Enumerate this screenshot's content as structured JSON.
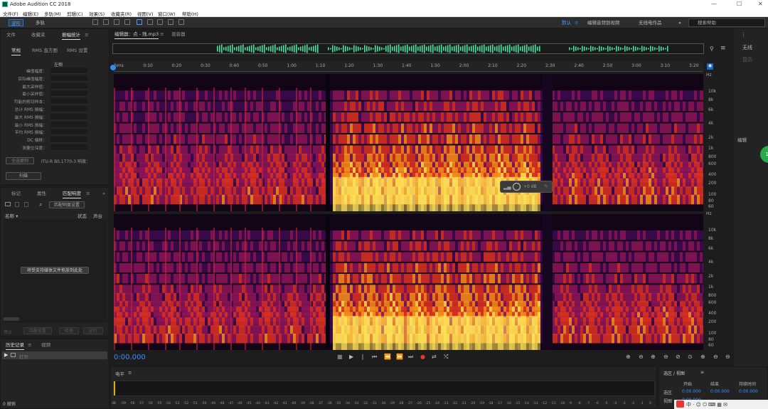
{
  "app": {
    "title": "Adobe Audition CC 2018",
    "window_controls": [
      "—",
      "☐",
      "✕"
    ]
  },
  "menu": [
    "文件(F)",
    "编辑(E)",
    "多轨(M)",
    "剪辑(C)",
    "效果(S)",
    "收藏夹(R)",
    "视图(V)",
    "窗口(W)",
    "帮助(H)"
  ],
  "toolbar": {
    "waveform": "波形",
    "multitrack": "多轨",
    "workspaces": [
      "默认",
      "编辑音频到视频",
      "无线电作品"
    ],
    "search_placeholder": "搜索帮助"
  },
  "left_top": {
    "tabs": [
      "文件",
      "收藏夹",
      "振幅统计"
    ],
    "subtabs": [
      "常规",
      "RMS 直方图",
      "RMS 设置"
    ],
    "channel": "左侧",
    "stats": [
      "峰值幅度：",
      "实际峰值幅度：",
      "最大采样值：",
      "最小采样值：",
      "可能的剪切样本：",
      "总计 RMS 振幅：",
      "最大 RMS 振幅：",
      "最小 RMS 振幅：",
      "平均 RMS 振幅：",
      "DC 偏移：",
      "测量位深度："
    ],
    "scan_btn": "扫描",
    "selection_btn": "全选复制",
    "loudness_note": "ITU-R BS.1770-3 响度："
  },
  "left_mid": {
    "tabs": [
      "标记",
      "属性",
      "匹配响度"
    ],
    "match_btn": "匹配响度设置",
    "col_name": "名称 ▾",
    "col_status": "状态",
    "col_channel": "声台",
    "drop_hint": "将受支持媒体文件拖放到此处",
    "footer": [
      "停止",
      "匹配设置",
      "检查",
      "运行"
    ]
  },
  "history": {
    "tabs": [
      "历史记录",
      "视频"
    ],
    "items": [
      "打开"
    ],
    "undo": "0 撤销"
  },
  "editor": {
    "tabs": [
      "编辑器：点 - 残.mp3",
      "混音器"
    ],
    "time": "0:00.000",
    "ruler": [
      "hms",
      "0:10",
      "0:20",
      "0:30",
      "0:40",
      "0:50",
      "1:00",
      "1:10",
      "1:20",
      "1:30",
      "1:40",
      "1:50",
      "2:00",
      "2:10",
      "2:20",
      "2:30",
      "2:40",
      "2:50",
      "3:00",
      "3:10",
      "3:20"
    ],
    "hz_labels": [
      "Hz",
      "10k",
      "8k",
      "6k",
      "4k",
      "2k",
      "1k",
      "800",
      "600",
      "400",
      "200",
      "100",
      "80",
      "60"
    ],
    "hud": "+0 dB"
  },
  "levels": {
    "title": "电平",
    "ticks": [
      "dB",
      "-59",
      "-58",
      "-57",
      "-56",
      "-55",
      "-54",
      "-53",
      "-52",
      "-51",
      "-50",
      "-49",
      "-48",
      "-47",
      "-46",
      "-45",
      "-44",
      "-43",
      "-42",
      "-41",
      "-40",
      "-39",
      "-38",
      "-37",
      "-36",
      "-35",
      "-34",
      "-33",
      "-32",
      "-31",
      "-30",
      "-29",
      "-28",
      "-27",
      "-26",
      "-25",
      "-24",
      "-23",
      "-22",
      "-21",
      "-20",
      "-19",
      "-18",
      "-17",
      "-16",
      "-15",
      "-14",
      "-13",
      "-12",
      "-11",
      "-10",
      "-9",
      "-8",
      "-7",
      "-6",
      "-5",
      "-4",
      "-3",
      "-2",
      "-1",
      "0"
    ]
  },
  "selection": {
    "title": "选区 / 视图",
    "cols": [
      "开始",
      "结束",
      "持续时间"
    ],
    "rows": [
      "选区",
      "视图"
    ],
    "sel_vals": [
      "0:00.000",
      "0:00.000",
      "0:00.000"
    ],
    "view_val": "0:00.000"
  },
  "right": {
    "labels": [
      "无线",
      "显示",
      "编辑"
    ]
  }
}
